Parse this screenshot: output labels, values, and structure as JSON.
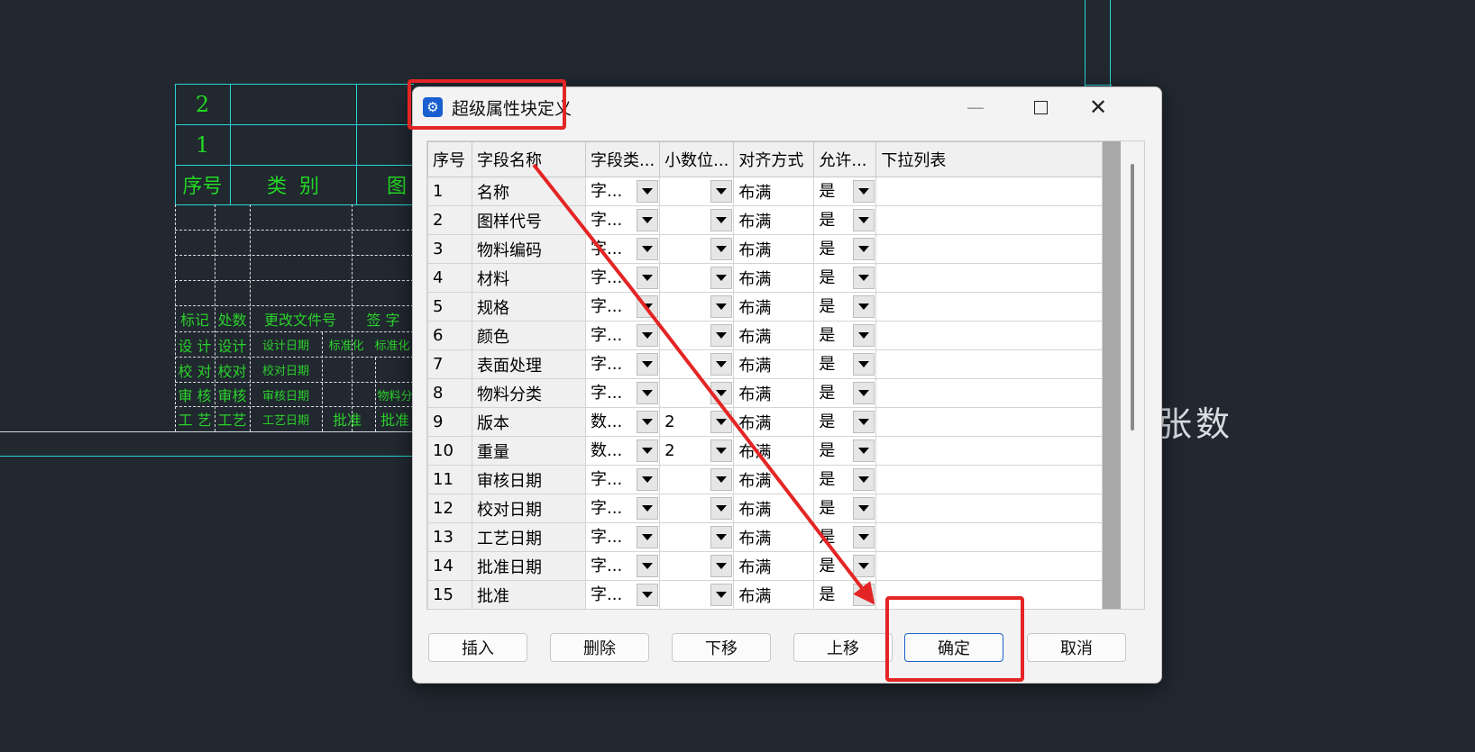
{
  "window": {
    "title": "超级属性块定义",
    "minimize": "—",
    "maximize": "",
    "close": "✕"
  },
  "background": {
    "right_label": "张数",
    "cad_rows": [
      {
        "num": "2"
      },
      {
        "num": "1"
      }
    ],
    "header": {
      "col1": "序号",
      "col2": "类  别",
      "col3": "图"
    },
    "sig_rows": [
      [
        "标记",
        "处数",
        "更改文件号",
        "签 字"
      ],
      [
        "设 计",
        "设计",
        "设计日期",
        "标准化",
        "标准化"
      ],
      [
        "校 对",
        "校对",
        "校对日期"
      ],
      [
        "审 核",
        "审核",
        "审核日期",
        "物料分"
      ],
      [
        "工 艺",
        "工艺",
        "工艺日期",
        "批准",
        "批准"
      ]
    ]
  },
  "grid": {
    "columns": [
      "序号",
      "字段名称",
      "字段类...",
      "小数位...",
      "对齐方式",
      "允许...",
      "下拉列表"
    ],
    "rows": [
      {
        "idx": "1",
        "name": "名称",
        "type": "字...",
        "dec": "",
        "align": "布满",
        "allow": "是",
        "list": ""
      },
      {
        "idx": "2",
        "name": "图样代号",
        "type": "字...",
        "dec": "",
        "align": "布满",
        "allow": "是",
        "list": ""
      },
      {
        "idx": "3",
        "name": "物料编码",
        "type": "字...",
        "dec": "",
        "align": "布满",
        "allow": "是",
        "list": ""
      },
      {
        "idx": "4",
        "name": "材料",
        "type": "字...",
        "dec": "",
        "align": "布满",
        "allow": "是",
        "list": ""
      },
      {
        "idx": "5",
        "name": "规格",
        "type": "字...",
        "dec": "",
        "align": "布满",
        "allow": "是",
        "list": ""
      },
      {
        "idx": "6",
        "name": "颜色",
        "type": "字...",
        "dec": "",
        "align": "布满",
        "allow": "是",
        "list": ""
      },
      {
        "idx": "7",
        "name": "表面处理",
        "type": "字...",
        "dec": "",
        "align": "布满",
        "allow": "是",
        "list": ""
      },
      {
        "idx": "8",
        "name": "物料分类",
        "type": "字...",
        "dec": "",
        "align": "布满",
        "allow": "是",
        "list": ""
      },
      {
        "idx": "9",
        "name": "版本",
        "type": "数...",
        "dec": "2",
        "align": "布满",
        "allow": "是",
        "list": ""
      },
      {
        "idx": "10",
        "name": "重量",
        "type": "数...",
        "dec": "2",
        "align": "布满",
        "allow": "是",
        "list": ""
      },
      {
        "idx": "11",
        "name": "审核日期",
        "type": "字...",
        "dec": "",
        "align": "布满",
        "allow": "是",
        "list": ""
      },
      {
        "idx": "12",
        "name": "校对日期",
        "type": "字...",
        "dec": "",
        "align": "布满",
        "allow": "是",
        "list": ""
      },
      {
        "idx": "13",
        "name": "工艺日期",
        "type": "字...",
        "dec": "",
        "align": "布满",
        "allow": "是",
        "list": ""
      },
      {
        "idx": "14",
        "name": "批准日期",
        "type": "字...",
        "dec": "",
        "align": "布满",
        "allow": "是",
        "list": ""
      },
      {
        "idx": "15",
        "name": "批准",
        "type": "字...",
        "dec": "",
        "align": "布满",
        "allow": "是",
        "list": ""
      }
    ]
  },
  "buttons": {
    "insert": "插入",
    "delete": "删除",
    "move_down": "下移",
    "move_up": "上移",
    "ok": "确定",
    "cancel": "取消"
  },
  "colors": {
    "cad_bg": "#212830",
    "cad_green": "#23d823",
    "cad_cyan": "#2bd6d6",
    "highlight_red": "#e42525",
    "primary_button_border": "#1a64c8"
  }
}
